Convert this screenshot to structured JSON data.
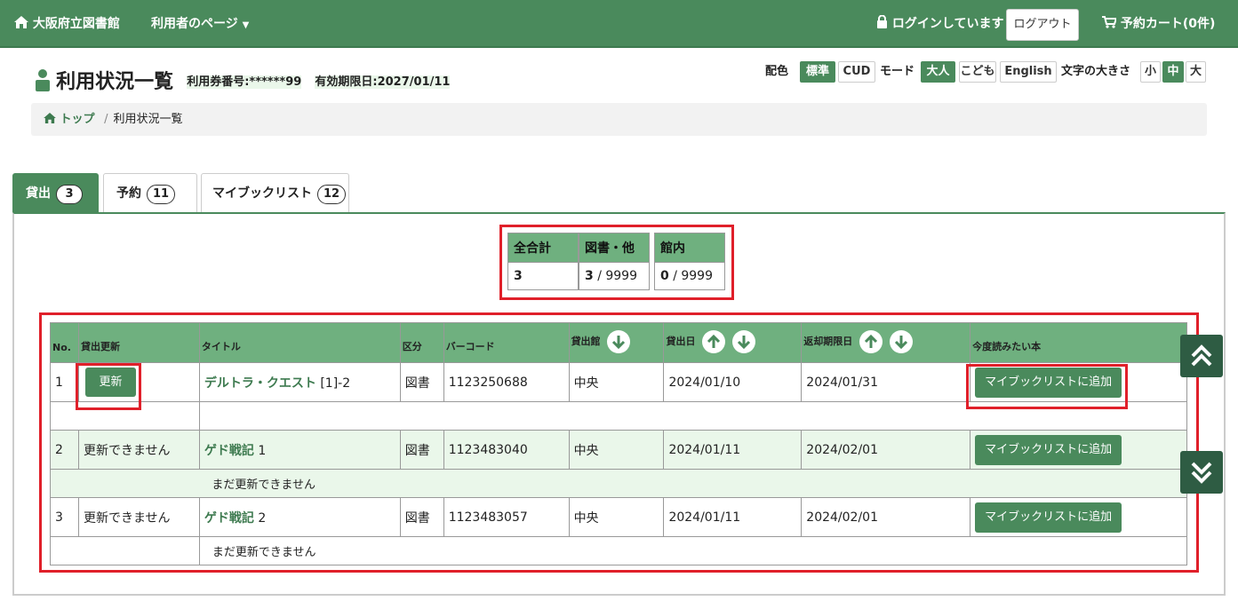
{
  "nav": {
    "home": "大阪府立図書館",
    "user_page": "利用者のページ",
    "login_status": "ログインしています",
    "logout": "ログアウト",
    "cart": "予約カート(0件)"
  },
  "header": {
    "title": "利用状況一覧",
    "card_number": "利用券番号:******99",
    "expiry": "有効期限日:2027/01/11"
  },
  "settings": {
    "color_label": "配色",
    "color_standard": "標準",
    "color_cud": "CUD",
    "mode_label": "モード",
    "mode_adult": "大人",
    "mode_kids": "こども",
    "mode_english": "English",
    "size_label": "文字の大きさ",
    "size_small": "小",
    "size_medium": "中",
    "size_large": "大"
  },
  "breadcrumb": {
    "home": "トップ",
    "sep": "/",
    "current": "利用状況一覧"
  },
  "tabs": [
    {
      "label": "貸出",
      "count": "3"
    },
    {
      "label": "予約",
      "count": "11"
    },
    {
      "label": "マイブックリスト",
      "count": "12"
    }
  ],
  "summary": {
    "total_header": "全合計",
    "total_value": "3",
    "books_header": "図書・他",
    "books_value": "3",
    "books_limit": "/ 9999",
    "inlib_header": "館内",
    "inlib_value": "0",
    "inlib_limit": "/ 9999"
  },
  "table": {
    "headers": {
      "no": "No.",
      "renew": "貸出更新",
      "title": "タイトル",
      "type": "区分",
      "barcode": "バーコード",
      "library": "貸出館",
      "loan_date": "貸出日",
      "due_date": "返却期限日",
      "want": "今度読みたい本"
    },
    "rows": [
      {
        "no": "1",
        "renew": "更新",
        "title": "デルトラ・クエスト",
        "vol": "[1]-2",
        "type": "図書",
        "barcode": "1123250688",
        "library": "中央",
        "loan_date": "2024/01/10",
        "due_date": "2024/01/31",
        "add": "マイブックリストに追加",
        "note": ""
      },
      {
        "no": "2",
        "renew": "更新できません",
        "title": "ゲド戦記",
        "vol": "1",
        "type": "図書",
        "barcode": "1123483040",
        "library": "中央",
        "loan_date": "2024/01/11",
        "due_date": "2024/02/01",
        "add": "マイブックリストに追加",
        "note": "まだ更新できません"
      },
      {
        "no": "3",
        "renew": "更新できません",
        "title": "ゲド戦記",
        "vol": "2",
        "type": "図書",
        "barcode": "1123483057",
        "library": "中央",
        "loan_date": "2024/01/11",
        "due_date": "2024/02/01",
        "add": "マイブックリストに追加",
        "note": "まだ更新できません"
      }
    ]
  },
  "colors": {
    "brand": "#4a8a5c",
    "header_green": "#6fb07f",
    "alt_row": "#eaf7ea",
    "highlight": "#e0202a",
    "scroll": "#2e5c43"
  }
}
